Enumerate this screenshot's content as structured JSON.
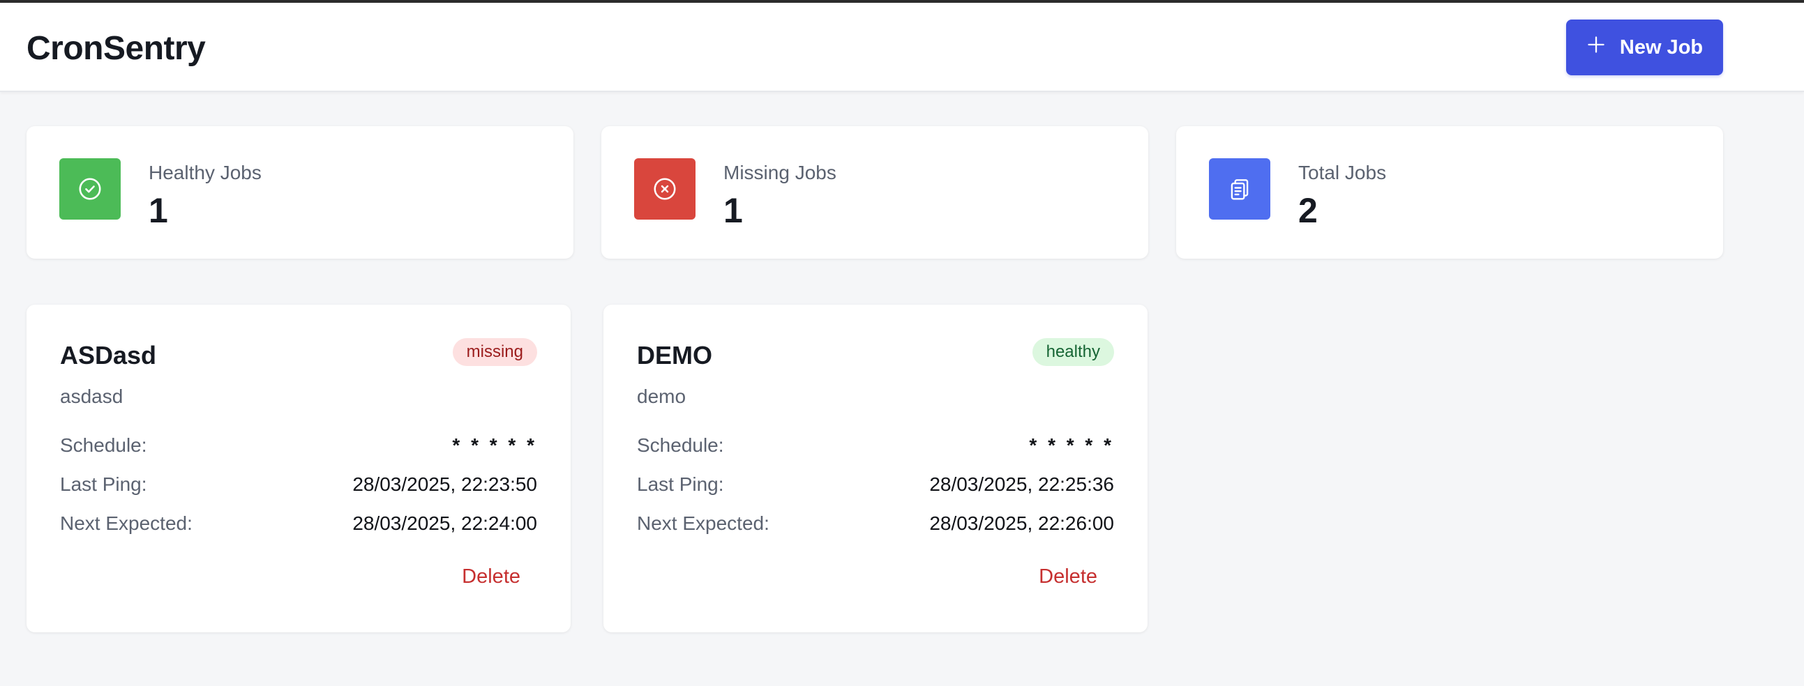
{
  "app": {
    "title": "CronSentry",
    "new_job_label": "New Job"
  },
  "stats": [
    {
      "label": "Healthy Jobs",
      "value": "1",
      "icon": "check-circle-icon",
      "color": "#4cbb57"
    },
    {
      "label": "Missing Jobs",
      "value": "1",
      "icon": "x-circle-icon",
      "color": "#d9463d"
    },
    {
      "label": "Total Jobs",
      "value": "2",
      "icon": "clipboard-icon",
      "color": "#4f6ef0"
    }
  ],
  "field_labels": {
    "schedule": "Schedule:",
    "last_ping": "Last Ping:",
    "next_expected": "Next Expected:",
    "delete": "Delete"
  },
  "jobs": [
    {
      "name": "ASDasd",
      "description": "asdasd",
      "status": "missing",
      "schedule": "* * * * *",
      "last_ping": "28/03/2025, 22:23:50",
      "next_expected": "28/03/2025, 22:24:00"
    },
    {
      "name": "DEMO",
      "description": "demo",
      "status": "healthy",
      "schedule": "* * * * *",
      "last_ping": "28/03/2025, 22:25:36",
      "next_expected": "28/03/2025, 22:26:00"
    }
  ],
  "colors": {
    "primary": "#3f51e0",
    "missing_badge_bg": "#fde0e0",
    "missing_badge_text": "#9b1c1c",
    "healthy_badge_bg": "#dcf7df",
    "healthy_badge_text": "#166534",
    "delete_text": "#c62f2f"
  }
}
